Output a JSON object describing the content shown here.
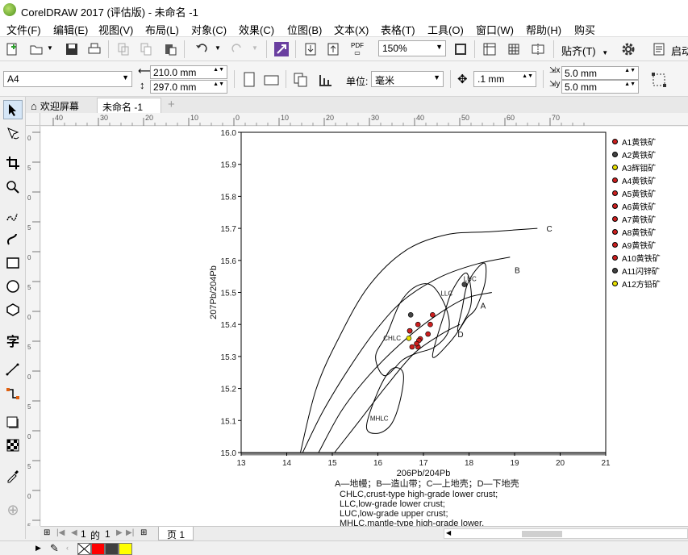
{
  "app": {
    "title": "CorelDRAW 2017 (评估版) - 未命名 -1"
  },
  "menu": [
    "文件(F)",
    "编辑(E)",
    "视图(V)",
    "布局(L)",
    "对象(C)",
    "效果(C)",
    "位图(B)",
    "文本(X)",
    "表格(T)",
    "工具(O)",
    "窗口(W)",
    "帮助(H)",
    "购买"
  ],
  "toolbar": {
    "zoom": "150%",
    "pdf_label": "PDF",
    "snap_label": "贴齐(T)",
    "launch_label": "启动"
  },
  "property_bar": {
    "page_size": "A4",
    "width": "210.0 mm",
    "height": "297.0 mm",
    "unit_label": "单位:",
    "unit": "毫米",
    "nudge": ".1 mm",
    "dup_x": "5.0 mm",
    "dup_y": "5.0 mm"
  },
  "tabs": {
    "welcome": "欢迎屏幕",
    "document": "未命名 -1"
  },
  "ruler": {
    "h": [
      "40",
      "30",
      "20",
      "10",
      "0",
      "10",
      "20",
      "30",
      "40",
      "50",
      "60",
      "70"
    ],
    "v": [
      "0",
      "5",
      "0",
      "5",
      "0",
      "5",
      "0",
      "5",
      "0",
      "5",
      "0",
      "5",
      "0",
      "5"
    ]
  },
  "chart_data": {
    "type": "scatter",
    "title": "",
    "xlabel": "206Pb/204Pb",
    "ylabel": "207Pb/204Pb",
    "xlim": [
      13,
      21
    ],
    "ylim": [
      15.0,
      16.0
    ],
    "x_ticks": [
      "13",
      "14",
      "15",
      "16",
      "17",
      "18",
      "19",
      "20",
      "21"
    ],
    "y_ticks": [
      "15.0",
      "15.1",
      "15.2",
      "15.3",
      "15.4",
      "15.5",
      "15.6",
      "15.7",
      "15.8",
      "15.9",
      "16.0"
    ],
    "curves": [
      {
        "name": "A",
        "points": [
          [
            14.7,
            15.0
          ],
          [
            15.2,
            15.13
          ],
          [
            15.8,
            15.24
          ],
          [
            16.5,
            15.34
          ],
          [
            17.2,
            15.42
          ],
          [
            17.9,
            15.48
          ],
          [
            18.5,
            15.5
          ]
        ]
      },
      {
        "name": "B",
        "points": [
          [
            14.35,
            15.0
          ],
          [
            14.8,
            15.13
          ],
          [
            15.4,
            15.27
          ],
          [
            16.0,
            15.39
          ],
          [
            16.6,
            15.48
          ],
          [
            17.4,
            15.55
          ],
          [
            18.2,
            15.59
          ],
          [
            18.9,
            15.61
          ]
        ]
      },
      {
        "name": "C",
        "points": [
          [
            14.3,
            15.0
          ],
          [
            14.65,
            15.2
          ],
          [
            15.15,
            15.36
          ],
          [
            15.8,
            15.52
          ],
          [
            16.6,
            15.63
          ],
          [
            17.5,
            15.68
          ],
          [
            18.5,
            15.69
          ],
          [
            19.5,
            15.7
          ]
        ]
      },
      {
        "name": "D",
        "points": [
          [
            15.05,
            15.0
          ],
          [
            15.6,
            15.1
          ],
          [
            16.2,
            15.21
          ],
          [
            16.8,
            15.31
          ],
          [
            17.4,
            15.37
          ],
          [
            17.8,
            15.4
          ]
        ]
      }
    ],
    "curve_labels": [
      {
        "text": "A",
        "x": 18.25,
        "y": 15.45
      },
      {
        "text": "B",
        "x": 19.0,
        "y": 15.56
      },
      {
        "text": "C",
        "x": 19.7,
        "y": 15.69
      },
      {
        "text": "D",
        "x": 17.75,
        "y": 15.36
      }
    ],
    "fields": [
      {
        "name": "LUC",
        "points": [
          [
            17.75,
            15.38
          ],
          [
            17.85,
            15.45
          ],
          [
            17.95,
            15.52
          ],
          [
            18.15,
            15.57
          ],
          [
            18.35,
            15.59
          ],
          [
            18.35,
            15.53
          ],
          [
            18.15,
            15.45
          ],
          [
            17.95,
            15.42
          ]
        ]
      },
      {
        "name": "LLC",
        "points": [
          [
            17.2,
            15.3
          ],
          [
            17.45,
            15.43
          ],
          [
            17.65,
            15.51
          ],
          [
            17.95,
            15.56
          ],
          [
            18.05,
            15.47
          ],
          [
            17.85,
            15.4
          ],
          [
            17.55,
            15.34
          ]
        ]
      },
      {
        "name": "CHLC",
        "points": [
          [
            15.95,
            15.3
          ],
          [
            16.2,
            15.37
          ],
          [
            16.5,
            15.47
          ],
          [
            16.85,
            15.52
          ],
          [
            17.2,
            15.52
          ],
          [
            17.5,
            15.45
          ],
          [
            17.55,
            15.38
          ],
          [
            17.25,
            15.33
          ],
          [
            16.85,
            15.31
          ],
          [
            16.55,
            15.29
          ],
          [
            16.15,
            15.24
          ]
        ]
      },
      {
        "name": "MHLC",
        "points": [
          [
            15.75,
            15.08
          ],
          [
            16.0,
            15.19
          ],
          [
            16.3,
            15.26
          ],
          [
            16.55,
            15.25
          ],
          [
            16.5,
            15.17
          ],
          [
            16.3,
            15.09
          ],
          [
            16.0,
            15.06
          ]
        ]
      }
    ],
    "field_labels": [
      {
        "text": "LUC",
        "x": 17.88,
        "y": 15.535
      },
      {
        "text": "LLC",
        "x": 17.38,
        "y": 15.49
      },
      {
        "text": "CHLC",
        "x": 16.12,
        "y": 15.35
      },
      {
        "text": "MHLC",
        "x": 15.83,
        "y": 15.1
      }
    ],
    "series": [
      {
        "name": "A1黄铁矿",
        "color": "#cc1f1f",
        "x": [
          16.75
        ],
        "y": [
          15.33
        ]
      },
      {
        "name": "A2黄铁矿",
        "color": "#444444",
        "x": [
          16.72
        ],
        "y": [
          15.43
        ]
      },
      {
        "name": "A3辉钼矿",
        "color": "#e8e000",
        "x": [
          16.68
        ],
        "y": [
          15.357
        ]
      },
      {
        "name": "A4黄铁矿",
        "color": "#cc1f1f",
        "x": [
          16.88
        ],
        "y": [
          15.4
        ]
      },
      {
        "name": "A5黄铁矿",
        "color": "#cc1f1f",
        "x": [
          16.93
        ],
        "y": [
          15.355
        ]
      },
      {
        "name": "A6黄铁矿",
        "color": "#cc1f1f",
        "x": [
          16.9
        ],
        "y": [
          15.35
        ]
      },
      {
        "name": "A7黄铁矿",
        "color": "#cc1f1f",
        "x": [
          17.1
        ],
        "y": [
          15.37
        ]
      },
      {
        "name": "A8黄铁矿",
        "color": "#cc1f1f",
        "x": [
          17.2
        ],
        "y": [
          15.43
        ]
      },
      {
        "name": "A9黄铁矿",
        "color": "#cc1f1f",
        "x": [
          17.15
        ],
        "y": [
          15.4
        ]
      },
      {
        "name": "A10黄铁矿",
        "color": "#cc1f1f",
        "x": [
          16.88
        ],
        "y": [
          15.33
        ]
      },
      {
        "name": "A11闪锌矿",
        "color": "#444444",
        "x": [
          17.9
        ],
        "y": [
          15.525
        ]
      },
      {
        "name": "A12方铅矿",
        "color": "#e8e000",
        "x": [
          16.7
        ],
        "y": [
          15.38
        ]
      }
    ],
    "extra_points": [
      {
        "color": "#cc1f1f",
        "x": 16.85,
        "y": 15.34
      },
      {
        "color": "#cc1f1f",
        "x": 16.7,
        "y": 15.38
      }
    ],
    "legend_position": "right"
  },
  "captions": [
    "A—地幔；B—造山带；C—上地壳；D—下地壳",
    "CHLC,crust-type high-grade lower crust;",
    "LLC,low-grade lower crust;",
    "LUC,low-grade upper crust;",
    "MHLC,mantle-type high-grade lower."
  ],
  "pagebar": {
    "page_num": "1",
    "of_label": "的",
    "total": "1",
    "page_tab": "页 1"
  },
  "palette": {
    "colors": [
      "#ff0000",
      "#404040",
      "#ffff00"
    ]
  }
}
